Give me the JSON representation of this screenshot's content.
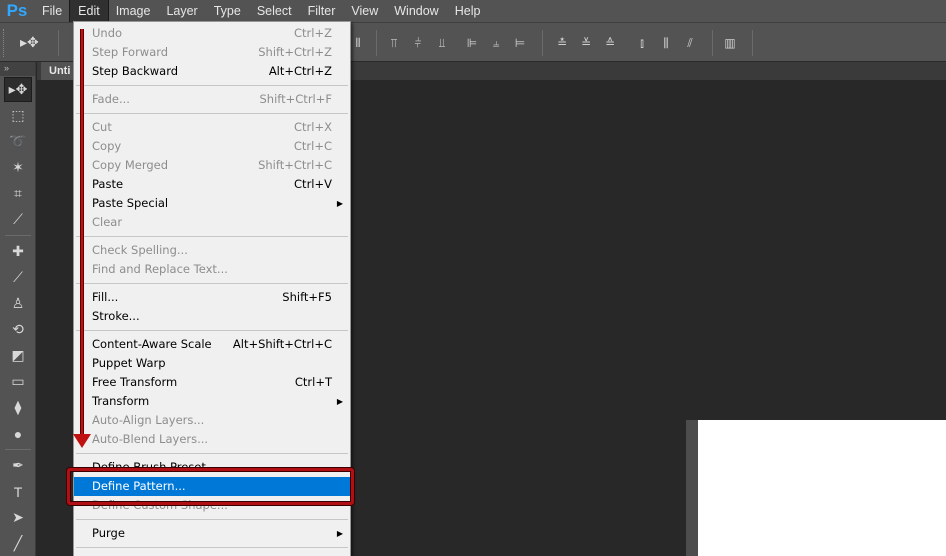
{
  "app": {
    "logo": "Ps"
  },
  "menubar": {
    "items": [
      "File",
      "Edit",
      "Image",
      "Layer",
      "Type",
      "Select",
      "Filter",
      "View",
      "Window",
      "Help"
    ]
  },
  "options_bar": {
    "tool_preset_icon": "move-tool-icon"
  },
  "document": {
    "tab_label": "Unti"
  },
  "toolbox": {
    "header": "»",
    "tools": [
      "move-tool-icon",
      "marquee-tool-icon",
      "lasso-tool-icon",
      "magic-wand-icon",
      "crop-tool-icon",
      "eyedropper-icon",
      "healing-brush-icon",
      "brush-tool-icon",
      "clone-stamp-icon",
      "history-brush-icon",
      "eraser-icon",
      "gradient-tool-icon",
      "blur-tool-icon",
      "dodge-tool-icon",
      "pen-tool-icon",
      "type-tool-icon",
      "path-selection-icon",
      "line-tool-icon"
    ]
  },
  "edit_menu": {
    "groups": [
      [
        {
          "label": "Undo",
          "shortcut": "Ctrl+Z",
          "enabled": false
        },
        {
          "label": "Step Forward",
          "shortcut": "Shift+Ctrl+Z",
          "enabled": false
        },
        {
          "label": "Step Backward",
          "shortcut": "Alt+Ctrl+Z",
          "enabled": true
        }
      ],
      [
        {
          "label": "Fade...",
          "shortcut": "Shift+Ctrl+F",
          "enabled": false
        }
      ],
      [
        {
          "label": "Cut",
          "shortcut": "Ctrl+X",
          "enabled": false
        },
        {
          "label": "Copy",
          "shortcut": "Ctrl+C",
          "enabled": false
        },
        {
          "label": "Copy Merged",
          "shortcut": "Shift+Ctrl+C",
          "enabled": false
        },
        {
          "label": "Paste",
          "shortcut": "Ctrl+V",
          "enabled": true
        },
        {
          "label": "Paste Special",
          "shortcut": "",
          "enabled": true,
          "submenu": true
        },
        {
          "label": "Clear",
          "shortcut": "",
          "enabled": false
        }
      ],
      [
        {
          "label": "Check Spelling...",
          "shortcut": "",
          "enabled": false
        },
        {
          "label": "Find and Replace Text...",
          "shortcut": "",
          "enabled": false
        }
      ],
      [
        {
          "label": "Fill...",
          "shortcut": "Shift+F5",
          "enabled": true
        },
        {
          "label": "Stroke...",
          "shortcut": "",
          "enabled": true
        }
      ],
      [
        {
          "label": "Content-Aware Scale",
          "shortcut": "Alt+Shift+Ctrl+C",
          "enabled": true
        },
        {
          "label": "Puppet Warp",
          "shortcut": "",
          "enabled": true
        },
        {
          "label": "Free Transform",
          "shortcut": "Ctrl+T",
          "enabled": true
        },
        {
          "label": "Transform",
          "shortcut": "",
          "enabled": true,
          "submenu": true
        },
        {
          "label": "Auto-Align Layers...",
          "shortcut": "",
          "enabled": false
        },
        {
          "label": "Auto-Blend Layers...",
          "shortcut": "",
          "enabled": false
        }
      ],
      [
        {
          "label": "Define Brush Preset...",
          "shortcut": "",
          "enabled": true
        },
        {
          "label": "Define Pattern...",
          "shortcut": "",
          "enabled": true,
          "highlighted": true
        },
        {
          "label": "Define Custom Shape...",
          "shortcut": "",
          "enabled": false
        }
      ],
      [
        {
          "label": "Purge",
          "shortcut": "",
          "enabled": true,
          "submenu": true
        }
      ]
    ]
  },
  "annotation": {
    "color": "#c01010",
    "target": "Define Pattern..."
  }
}
